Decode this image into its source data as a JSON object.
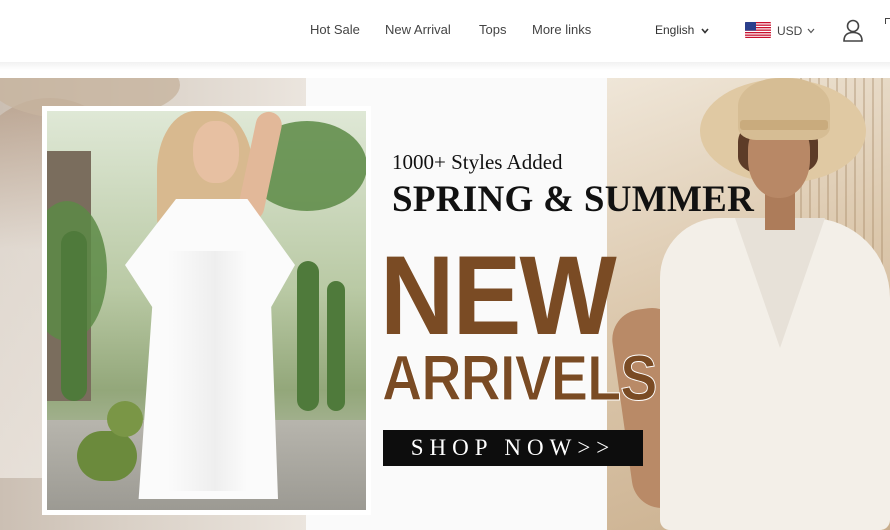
{
  "nav": {
    "items": [
      {
        "label": "Hot Sale"
      },
      {
        "label": "New Arrival"
      },
      {
        "label": "Tops"
      },
      {
        "label": "More links"
      }
    ]
  },
  "header": {
    "language": "English",
    "currency": "USD",
    "flag_icon": "us-flag-icon",
    "account_icon": "user-icon"
  },
  "banner": {
    "styles_added": "1000+ Styles Added",
    "season": "SPRING & SUMMER",
    "headline_1": "NEW",
    "headline_2": "ARRIVELS",
    "cta": "SHOP NOW>>",
    "colors": {
      "headline": "#7a4b24",
      "cta_bg": "#0d0d0d"
    }
  }
}
